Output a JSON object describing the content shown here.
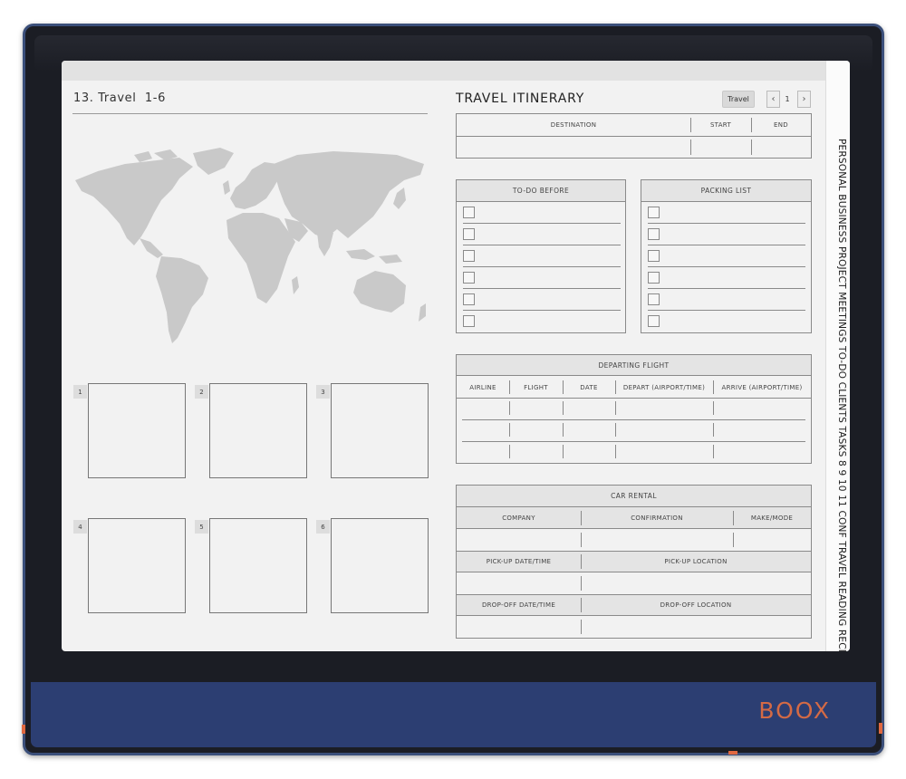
{
  "device": {
    "brand": "BOOX"
  },
  "page": {
    "title": "13. Travel  1-6"
  },
  "photos": [
    {
      "label": "1"
    },
    {
      "label": "2"
    },
    {
      "label": "3"
    },
    {
      "label": "4"
    },
    {
      "label": "5"
    },
    {
      "label": "6"
    }
  ],
  "itinerary": {
    "title": "TRAVEL ITINERARY",
    "tag": "Travel",
    "page_number": "1",
    "prev_icon": "chevron-left-icon",
    "next_icon": "chevron-right-icon",
    "destination_headers": [
      "DESTINATION",
      "START",
      "END"
    ]
  },
  "todo": {
    "header": "TO-DO BEFORE",
    "rows": 6
  },
  "packing": {
    "header": "PACKING LIST",
    "rows": 6
  },
  "departing_flight": {
    "header": "DEPARTING FLIGHT",
    "columns": [
      "AIRLINE",
      "FLIGHT",
      "DATE",
      "DEPART (AIRPORT/TIME)",
      "ARRIVE (AIRPORT/TIME)"
    ]
  },
  "car_rental": {
    "header": "CAR RENTAL",
    "columns": [
      "COMPANY",
      "CONFIRMATION",
      "MAKE/MODE"
    ],
    "pickup_date": "PICK-UP DATE/TIME",
    "pickup_location": "PICK-UP LOCATION",
    "dropoff_date": "DROP-OFF DATE/TIME",
    "dropoff_location": "DROP-OFF LOCATION"
  },
  "side_tabs": "PERSONAL BUSINESS PROJECT MEETINGS TO-DO CLIENTS TASKS 8 9 10 11 CONF TRAVEL READING RECIPES",
  "colors": {
    "chin": "#2c3e72",
    "brand": "#d46a45",
    "screen": "#f2f2f2"
  }
}
